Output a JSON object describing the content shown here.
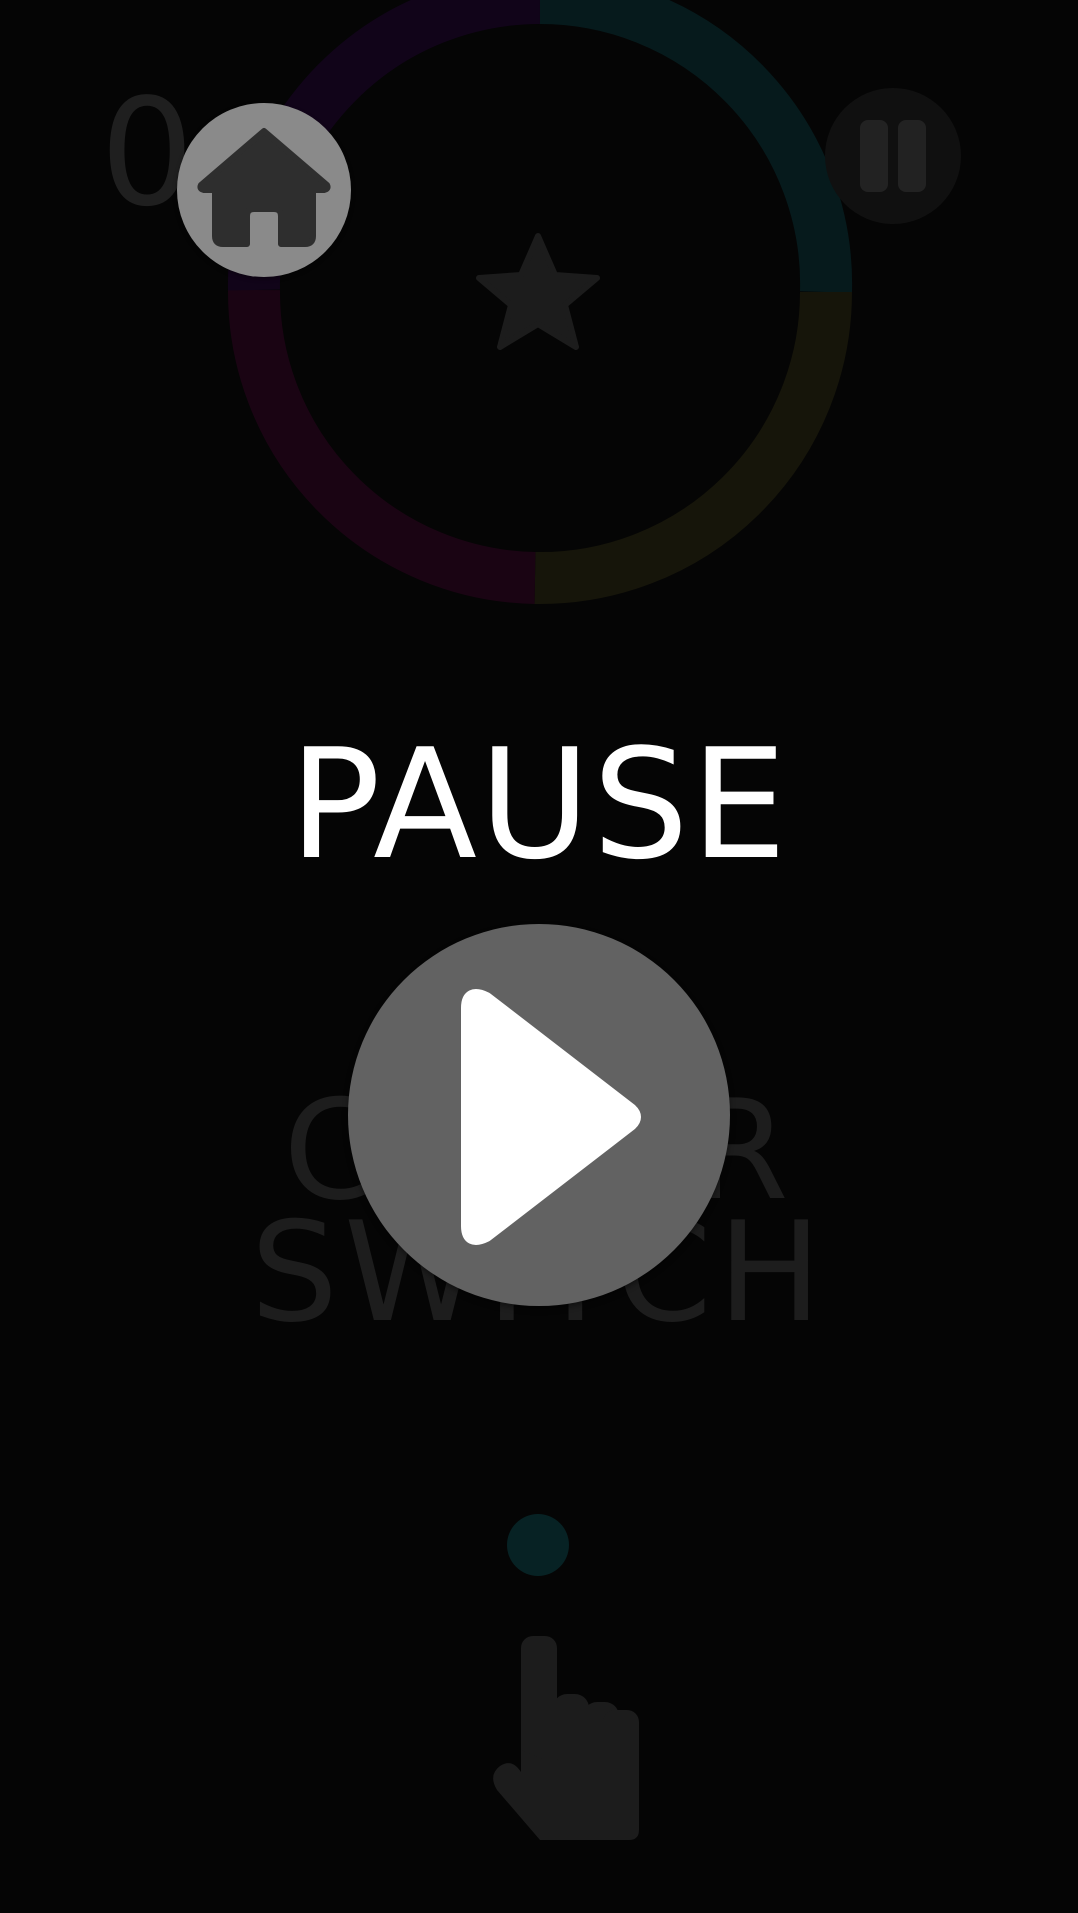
{
  "hud": {
    "score": "0"
  },
  "title": {
    "line1": "COLOR",
    "line2": "SWITCH"
  },
  "pause_menu": {
    "heading": "PAUSE"
  },
  "icons": {
    "home": "home-icon",
    "pause": "pause-icon",
    "play": "play-icon",
    "star": "star-icon",
    "tap_hand": "tap-hand-icon"
  },
  "colors": {
    "background": "#050505",
    "overlay_text": "#ffffff",
    "ring_purple": "#110419",
    "ring_teal": "#061a1c",
    "ring_yellow": "#16150a",
    "ring_magenta": "#1a0413",
    "player_ball": "#072224",
    "button_grey": "#626262",
    "home_button_grey": "#8a8a8a"
  }
}
